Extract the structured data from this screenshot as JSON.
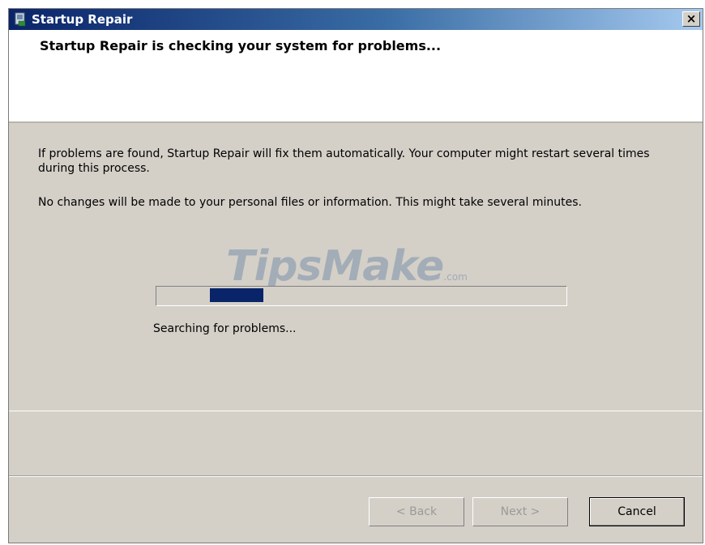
{
  "window": {
    "title": "Startup Repair",
    "close_label": "×"
  },
  "header": {
    "heading": "Startup Repair is checking your system for problems..."
  },
  "body": {
    "paragraph1": "If problems are found, Startup Repair will fix them automatically. Your computer might restart several times during this process.",
    "paragraph2": "No changes will be made to your personal files or information. This might take several minutes.",
    "status": "Searching for problems..."
  },
  "watermark": {
    "brand": "TipsMake",
    "suffix": ".com"
  },
  "progress": {
    "marquee_start": 0.13,
    "marquee_width": 0.13
  },
  "buttons": {
    "back": "< Back",
    "next": "Next >",
    "cancel": "Cancel"
  },
  "colors": {
    "progress_fill": "#0a246a",
    "dialog_bg": "#d4d0c8",
    "title_gradient_start": "#0a246a",
    "title_gradient_end": "#a6caf0"
  }
}
